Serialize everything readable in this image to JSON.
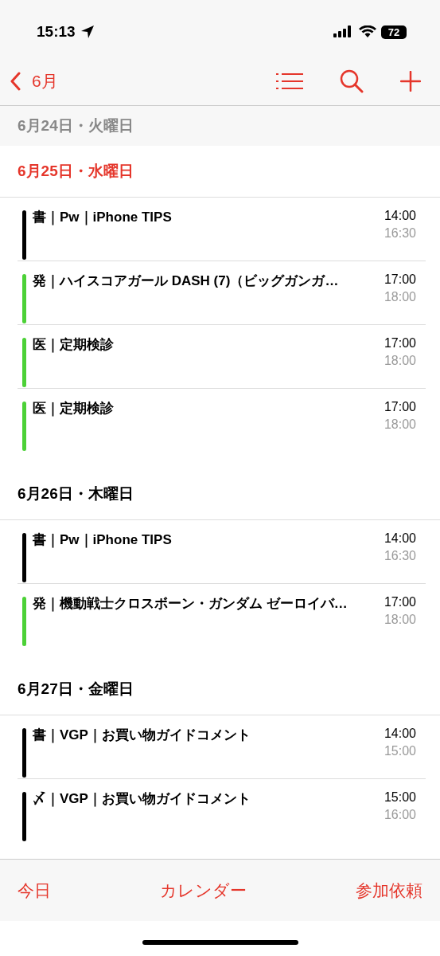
{
  "status_bar": {
    "time": "15:13",
    "battery": "72"
  },
  "nav": {
    "back": "6月"
  },
  "days": [
    {
      "kind": "past",
      "label": "6月24日・火曜日"
    },
    {
      "kind": "today",
      "label": "6月25日・水曜日",
      "events": [
        {
          "title": "書｜Pw｜iPhone TIPS",
          "start": "14:00",
          "end": "16:30",
          "color": "#000000"
        },
        {
          "title": "発｜ハイスコアガール DASH (7)（ビッグガンガ…",
          "start": "17:00",
          "end": "18:00",
          "color": "#4cd137"
        },
        {
          "title": "医｜定期検診",
          "start": "17:00",
          "end": "18:00",
          "color": "#4cd137"
        },
        {
          "title": "医｜定期検診",
          "start": "17:00",
          "end": "18:00",
          "color": "#4cd137"
        }
      ]
    },
    {
      "kind": "upcoming",
      "label": "6月26日・木曜日",
      "events": [
        {
          "title": "書｜Pw｜iPhone TIPS",
          "start": "14:00",
          "end": "16:30",
          "color": "#000000"
        },
        {
          "title": "発｜機動戦士クロスボーン・ガンダム ゼーロイバ…",
          "start": "17:00",
          "end": "18:00",
          "color": "#4cd137"
        }
      ]
    },
    {
      "kind": "upcoming",
      "label": "6月27日・金曜日",
      "events": [
        {
          "title": "書｜VGP｜お買い物ガイドコメント",
          "start": "14:00",
          "end": "15:00",
          "color": "#000000"
        },
        {
          "title": "〆｜VGP｜お買い物ガイドコメント",
          "start": "15:00",
          "end": "16:00",
          "color": "#000000"
        }
      ]
    }
  ],
  "tab_bar": [
    "今日",
    "カレンダー",
    "参加依頼"
  ]
}
